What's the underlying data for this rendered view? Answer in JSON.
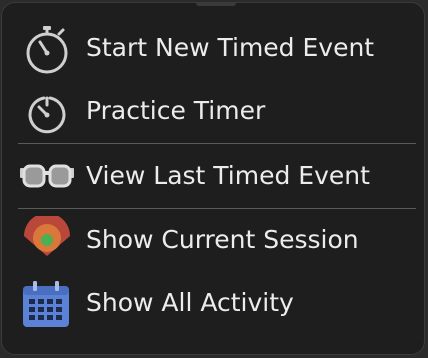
{
  "menu": {
    "items": [
      {
        "label": "Start New Timed Event",
        "icon": "stopwatch-icon"
      },
      {
        "label": "Practice Timer",
        "icon": "timer-icon"
      },
      {
        "label": "View Last Timed Event",
        "icon": "glasses-icon"
      },
      {
        "label": "Show Current Session",
        "icon": "session-target-icon"
      },
      {
        "label": "Show All Activity",
        "icon": "calendar-icon"
      }
    ]
  },
  "colors": {
    "background": "#1e1e1e",
    "text": "#ececec",
    "separator": "#5a5a5a",
    "calendar_blue": "#5b82d6",
    "session_orange": "#d9783a",
    "session_green": "#4caf50"
  }
}
